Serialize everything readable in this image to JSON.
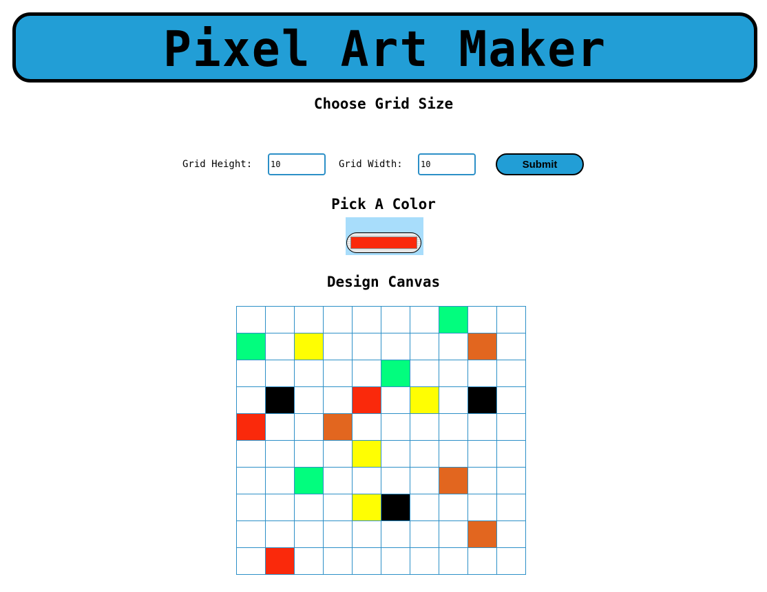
{
  "header": {
    "title": "Pixel Art Maker"
  },
  "grid_size": {
    "title": "Choose Grid Size",
    "height_label": "Grid Height:",
    "height_value": "10",
    "width_label": "Grid Width:",
    "width_value": "10",
    "submit_label": "Submit"
  },
  "color_picker": {
    "title": "Pick A Color",
    "selected_color": "#fa290b"
  },
  "canvas": {
    "title": "Design Canvas",
    "rows": 10,
    "cols": 10,
    "palette": {
      "green": "#02fd7e",
      "yellow": "#fffe02",
      "orange": "#e2661f",
      "black": "#000000",
      "red": "#fa290b"
    },
    "cells": [
      [
        "",
        "",
        "",
        "",
        "",
        "",
        "",
        "green",
        "",
        ""
      ],
      [
        "green",
        "",
        "yellow",
        "",
        "",
        "",
        "",
        "",
        "orange",
        ""
      ],
      [
        "",
        "",
        "",
        "",
        "",
        "green",
        "",
        "",
        "",
        ""
      ],
      [
        "",
        "black",
        "",
        "",
        "red",
        "",
        "yellow",
        "",
        "black",
        ""
      ],
      [
        "red",
        "",
        "",
        "orange",
        "",
        "",
        "",
        "",
        "",
        ""
      ],
      [
        "",
        "",
        "",
        "",
        "yellow",
        "",
        "",
        "",
        "",
        ""
      ],
      [
        "",
        "",
        "green",
        "",
        "",
        "",
        "",
        "orange",
        "",
        ""
      ],
      [
        "",
        "",
        "",
        "",
        "yellow",
        "black",
        "",
        "",
        "",
        ""
      ],
      [
        "",
        "",
        "",
        "",
        "",
        "",
        "",
        "",
        "orange",
        ""
      ],
      [
        "",
        "red",
        "",
        "",
        "",
        "",
        "",
        "",
        "",
        ""
      ]
    ]
  }
}
